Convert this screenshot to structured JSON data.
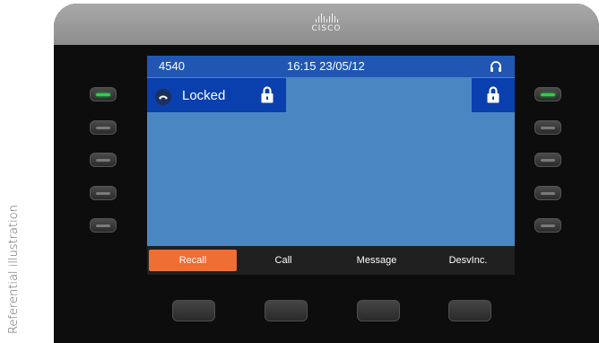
{
  "caption": "Referential illustration",
  "brand": "CISCO",
  "status": {
    "extension": "4540",
    "datetime": "16:15 23/05/12",
    "headset_icon": "headset-icon"
  },
  "line": {
    "label": "Locked",
    "icon": "handset-icon",
    "lock_icon": "lock-icon"
  },
  "softkeys": [
    "Recall",
    "Call",
    "Message",
    "DesvInc."
  ],
  "active_softkey": "Recall",
  "line_keys": {
    "left": [
      "green",
      "off",
      "off",
      "off",
      "off"
    ],
    "right": [
      "green",
      "off",
      "off",
      "off",
      "off"
    ]
  },
  "colors": {
    "screen": "#4a86c2",
    "status_bar": "#2157b3",
    "line_highlight": "#0a3fae",
    "softkey_bar": "#202020",
    "softkey_active": "#ee6e34",
    "led_on": "#27d344"
  }
}
